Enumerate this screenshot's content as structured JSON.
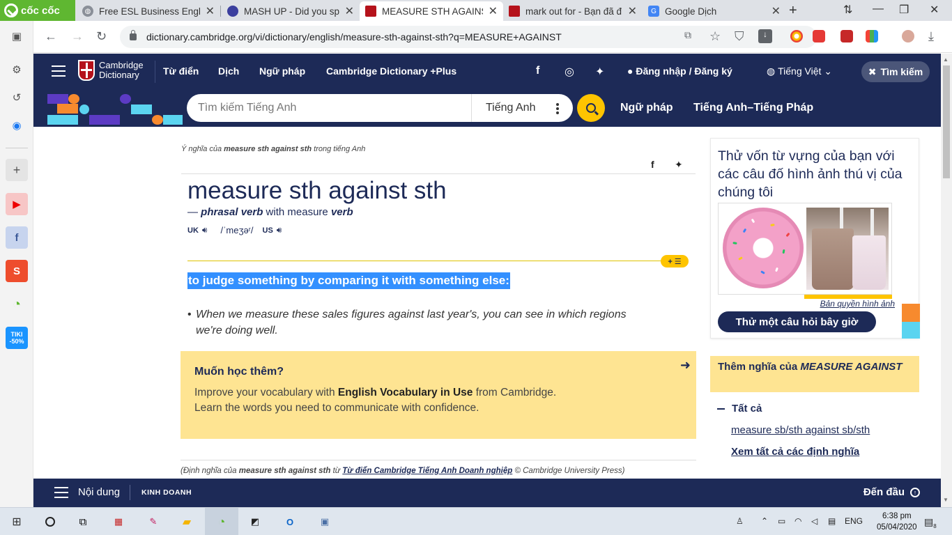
{
  "browser": {
    "brand": "cốc cốc",
    "tabs": [
      {
        "title": "Free ESL Business Englis"
      },
      {
        "title": "MASH UP - Did you spe"
      },
      {
        "title": "MEASURE STH AGAINST"
      },
      {
        "title": "mark out for - Bạn đã đ"
      },
      {
        "title": "Google Dịch"
      }
    ],
    "url": "dictionary.cambridge.org/vi/dictionary/english/measure-sth-against-sth?q=MEASURE+AGAINST"
  },
  "site": {
    "logo_line1": "Cambridge",
    "logo_line2": "Dictionary",
    "nav": [
      "Từ điển",
      "Dịch",
      "Ngữ pháp",
      "Cambridge Dictionary +Plus"
    ],
    "login": "Đăng nhập / Đăng ký",
    "language": "Tiếng Việt",
    "search_pill": "Tìm kiếm",
    "search_placeholder": "Tìm kiếm Tiếng Anh",
    "search_lang": "Tiếng Anh",
    "sub_links": [
      "Ngữ pháp",
      "Tiếng Anh–Tiếng Pháp"
    ]
  },
  "entry": {
    "crumb_pre": "Ý nghĩa của ",
    "crumb_word": "measure sth against sth",
    "crumb_post": " trong tiếng Anh",
    "headword": "measure sth against sth",
    "pos_dash": "— ",
    "pos": "phrasal verb",
    "pos_with": " with measure ",
    "pos_verb": "verb",
    "uk": "UK",
    "us": "US",
    "ipa": "/ˈmeʒəʳ/",
    "definition": "to judge something by comparing it with something else:",
    "example_line1": "When we measure these sales figures against last year's, you can see in which regions",
    "example_line2": "we're doing well.",
    "learn_title": "Muốn học thêm?",
    "learn_pre": "Improve your vocabulary with ",
    "learn_bold": "English Vocabulary in Use",
    "learn_post": " from Cambridge.",
    "learn_line2": "Learn the words you need to communicate with confidence.",
    "source_pre": "(Định nghĩa của ",
    "source_word": "measure sth against sth",
    "source_mid": " từ ",
    "source_link": "Từ điển Cambridge Tiếng Anh Doanh nghiệp",
    "source_post": " © Cambridge University Press)"
  },
  "sidebar": {
    "quiz_title": "Thử vốn từ vựng của bạn với các câu đố hình ảnh thú vị của chúng tôi",
    "copyright": "Bản quyền hình ảnh",
    "quiz_button": "Thử một câu hỏi bây giờ",
    "more_pre": "Thêm nghĩa của ",
    "more_word": "MEASURE AGAINST",
    "all": "Tất cả",
    "idiom": "measure sb/sth against sb/sth",
    "see_all": "Xem tất cả các định nghĩa"
  },
  "bottom": {
    "menu": "Nội dung",
    "tag": "KINH DOANH",
    "top": "Đến đầu"
  },
  "taskbar": {
    "lang": "ENG",
    "time": "6:38 pm",
    "date": "05/04/2020",
    "notifications": "8"
  },
  "colors": {
    "navy": "#1d2a57",
    "yellow": "#fec400",
    "light_yellow": "#fee492",
    "highlight": "#3390ff"
  }
}
